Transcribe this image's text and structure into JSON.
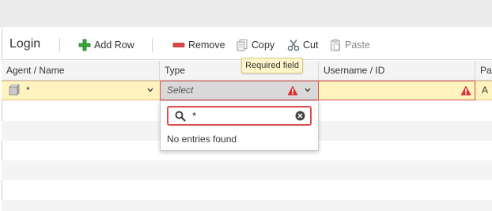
{
  "toolbar": {
    "title": "Login",
    "add_row_label": "Add Row",
    "remove_label": "Remove",
    "copy_label": "Copy",
    "cut_label": "Cut",
    "paste_label": "Paste"
  },
  "tooltip": {
    "text": "Required field"
  },
  "columns": [
    "Agent / Name",
    "Type",
    "Username / ID",
    "Pa"
  ],
  "edit_row": {
    "agent_value": "*",
    "type_placeholder": "Select",
    "username_value": "",
    "next_value": "A"
  },
  "dropdown": {
    "search_value": "*",
    "empty_message": "No entries found"
  },
  "colors": {
    "accent_red": "#d84a4a",
    "edit_row_bg": "#fff3c0",
    "tooltip_bg": "#fff5c8",
    "add_green": "#3aa83a"
  },
  "icons": [
    "plus-icon",
    "minus-icon",
    "copy-icon",
    "scissors-icon",
    "clipboard-icon",
    "warning-icon",
    "chevron-down-icon",
    "search-icon",
    "clear-icon",
    "agent-icon"
  ]
}
